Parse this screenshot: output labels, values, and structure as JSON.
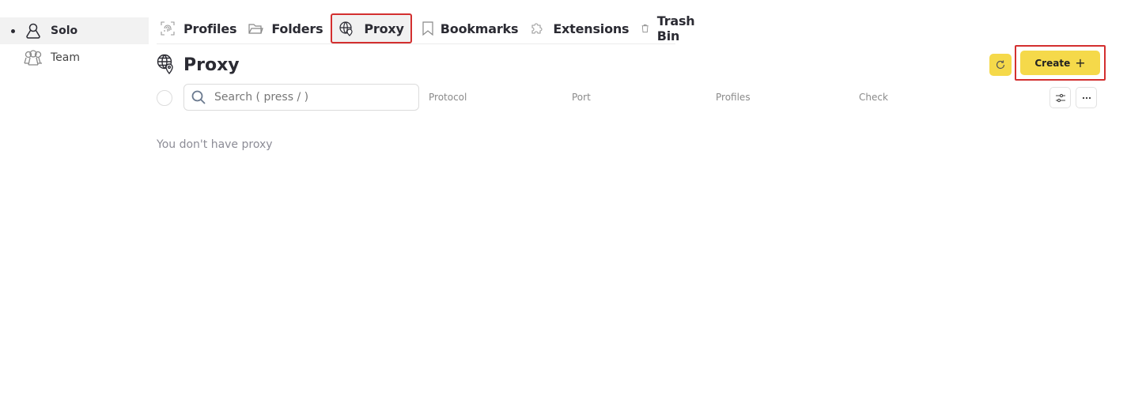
{
  "sidebar": {
    "items": [
      {
        "label": "Solo",
        "icon": "user-icon",
        "active": true
      },
      {
        "label": "Team",
        "icon": "users-icon",
        "active": false
      }
    ]
  },
  "tabs": [
    {
      "label": "Profiles",
      "icon": "fingerprint-icon"
    },
    {
      "label": "Folders",
      "icon": "folder-icon"
    },
    {
      "label": "Proxy",
      "icon": "globe-pin-icon",
      "active": true
    },
    {
      "label": "Bookmarks",
      "icon": "bookmark-icon"
    },
    {
      "label": "Extensions",
      "icon": "puzzle-icon"
    },
    {
      "label": "Trash Bin",
      "icon": "trash-icon"
    }
  ],
  "header": {
    "title": "Proxy",
    "icon": "globe-pin-icon",
    "refresh_icon": "refresh-icon",
    "create_label": "Create",
    "create_icon": "+"
  },
  "toolbar": {
    "search_placeholder": "Search ( press / )",
    "search_value": "",
    "columns": [
      "Protocol",
      "Port",
      "Profiles",
      "Check"
    ],
    "filter_icon": "sliders-icon",
    "more_icon": "more-icon"
  },
  "empty_state": "You don't have proxy",
  "colors": {
    "accent": "#f5d94a",
    "highlight_border": "#d32f2f"
  }
}
